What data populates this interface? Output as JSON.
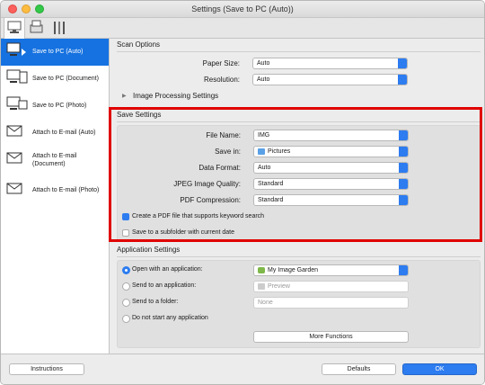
{
  "window": {
    "title": "Settings (Save to PC (Auto))"
  },
  "sidebar": {
    "items": [
      {
        "label": "Save to PC (Auto)",
        "selected": true
      },
      {
        "label": "Save to PC (Document)"
      },
      {
        "label": "Save to PC (Photo)"
      },
      {
        "label": "Attach to E-mail (Auto)"
      },
      {
        "label": "Attach to E-mail (Document)"
      },
      {
        "label": "Attach to E-mail (Photo)"
      }
    ]
  },
  "scan_options": {
    "header": "Scan Options",
    "paper_size": {
      "label": "Paper Size:",
      "value": "Auto"
    },
    "resolution": {
      "label": "Resolution:",
      "value": "Auto"
    },
    "image_processing": "Image Processing Settings"
  },
  "save_settings": {
    "header": "Save Settings",
    "file_name": {
      "label": "File Name:",
      "value": "IMG"
    },
    "save_in": {
      "label": "Save in:",
      "value": "Pictures"
    },
    "data_format": {
      "label": "Data Format:",
      "value": "Auto"
    },
    "jpeg_quality": {
      "label": "JPEG Image Quality:",
      "value": "Standard"
    },
    "pdf_compression": {
      "label": "PDF Compression:",
      "value": "Standard"
    },
    "keyword_pdf": {
      "label": "Create a PDF file that supports keyword search",
      "checked": true
    },
    "subfolder": {
      "label": "Save to a subfolder with current date",
      "checked": false
    }
  },
  "app_settings": {
    "header": "Application Settings",
    "open_with": {
      "label": "Open with an application:",
      "value": "My Image Garden",
      "selected": true
    },
    "send_app": {
      "label": "Send to an application:",
      "value": "Preview"
    },
    "send_folder": {
      "label": "Send to a folder:",
      "value": "None"
    },
    "no_app": {
      "label": "Do not start any application"
    },
    "more_functions": "More Functions"
  },
  "footer": {
    "instructions": "Instructions",
    "defaults": "Defaults",
    "ok": "OK"
  },
  "colors": {
    "accent": "#2d7cf0",
    "highlight": "#e00000"
  }
}
